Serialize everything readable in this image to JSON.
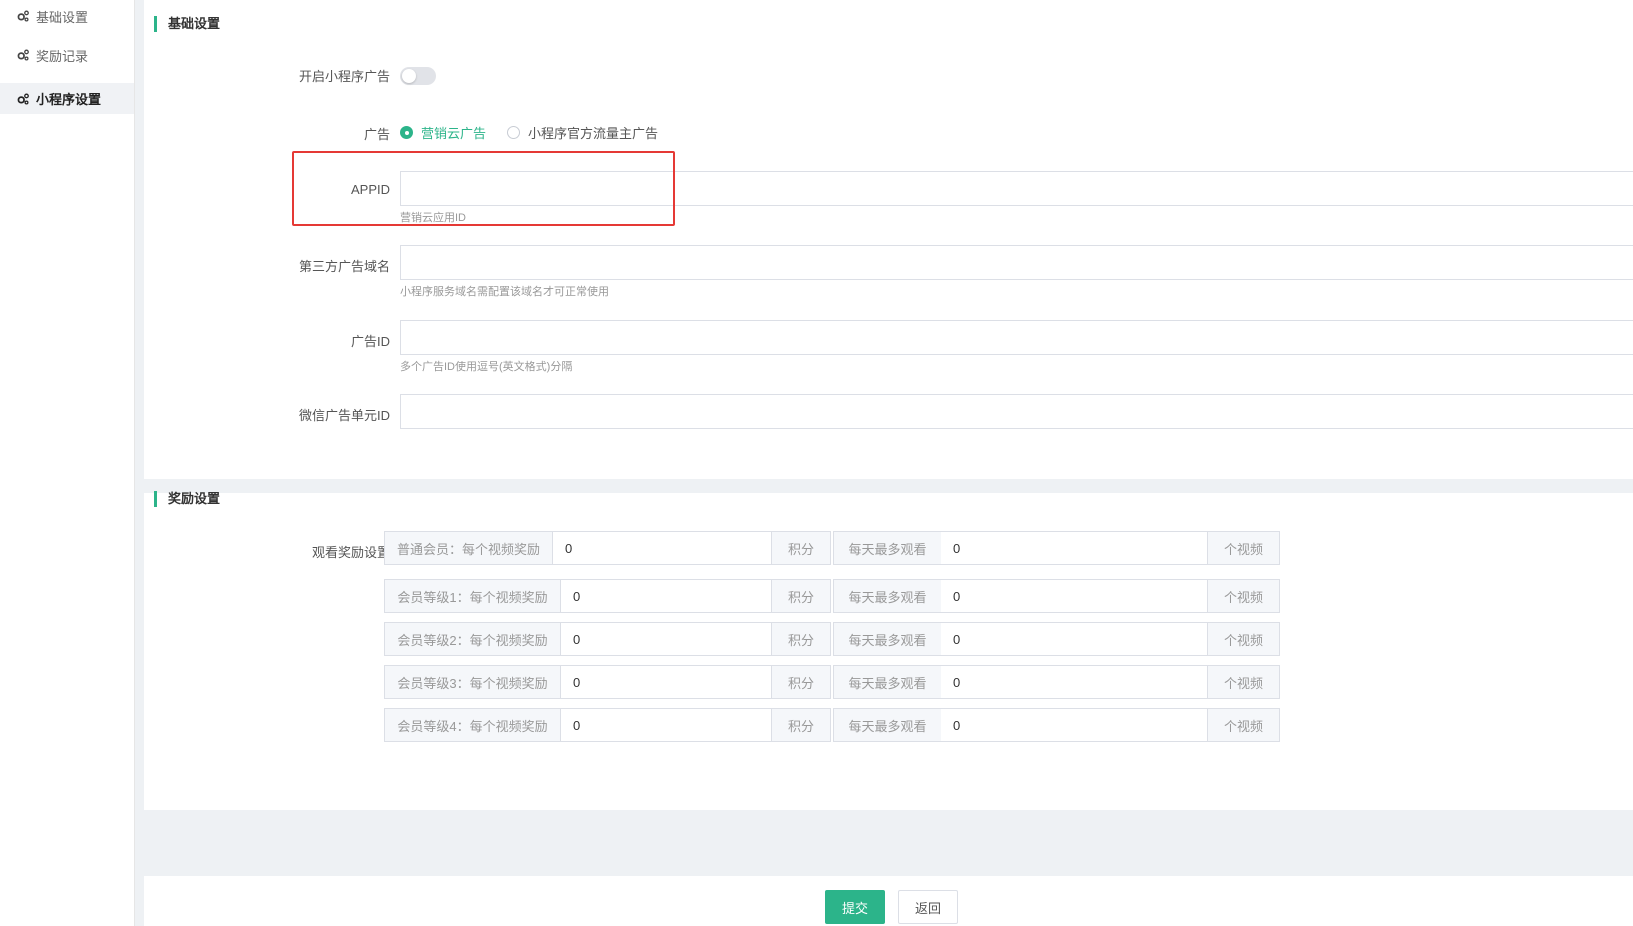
{
  "sidebar": {
    "items": [
      {
        "label": "基础设置",
        "icon": "gear-icon",
        "active": false
      },
      {
        "label": "奖励记录",
        "icon": "gear-icon",
        "active": false
      },
      {
        "label": "小程序设置",
        "icon": "gear-icon",
        "active": true
      }
    ]
  },
  "basic": {
    "title": "基础设置",
    "enable_ad_label": "开启小程序广告",
    "enable_ad_on": false,
    "ad_label": "广告",
    "ad_options": [
      "营销云广告",
      "小程序官方流量主广告"
    ],
    "ad_selected": "营销云广告",
    "appid_label": "APPID",
    "appid_value": "",
    "appid_hint": "营销云应用ID",
    "domain_label": "第三方广告域名",
    "domain_value": "",
    "domain_hint": "小程序服务域名需配置该域名才可正常使用",
    "adid_label": "广告ID",
    "adid_value": "",
    "adid_hint": "多个广告ID使用逗号(英文格式)分隔",
    "wx_unit_label": "微信广告单元ID",
    "wx_unit_value": ""
  },
  "reward": {
    "title": "奖励设置",
    "watch_label": "观看奖励设置",
    "points_suffix": "积分",
    "max_watch_label": "每天最多观看",
    "videos_suffix": "个视频",
    "rows": [
      {
        "prefix": "普通会员：每个视频奖励",
        "points": "0",
        "max": "0"
      },
      {
        "prefix": "会员等级1：每个视频奖励",
        "points": "0",
        "max": "0"
      },
      {
        "prefix": "会员等级2：每个视频奖励",
        "points": "0",
        "max": "0"
      },
      {
        "prefix": "会员等级3：每个视频奖励",
        "points": "0",
        "max": "0"
      },
      {
        "prefix": "会员等级4：每个视频奖励",
        "points": "0",
        "max": "0"
      }
    ]
  },
  "footer": {
    "submit_label": "提交",
    "back_label": "返回"
  },
  "colors": {
    "accent": "#2cb48a",
    "highlight": "#e53935"
  }
}
